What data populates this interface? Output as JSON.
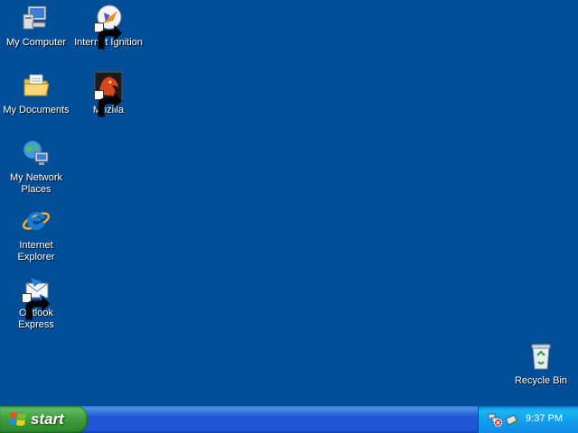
{
  "desktop": {
    "background": "#004E98",
    "icons": {
      "my_computer": "My Computer",
      "internet_ignition": "Internet Ignition",
      "my_documents": "My Documents",
      "mozilla": "Mozilla",
      "my_network_places": "My Network Places",
      "internet_explorer": "Internet Explorer",
      "outlook_express": "Outlook Express",
      "recycle_bin": "Recycle Bin"
    }
  },
  "taskbar": {
    "start_label": "start",
    "tray_icons": [
      "network-error-icon",
      "safely-remove-hardware-icon"
    ],
    "clock": "9:37 PM"
  }
}
